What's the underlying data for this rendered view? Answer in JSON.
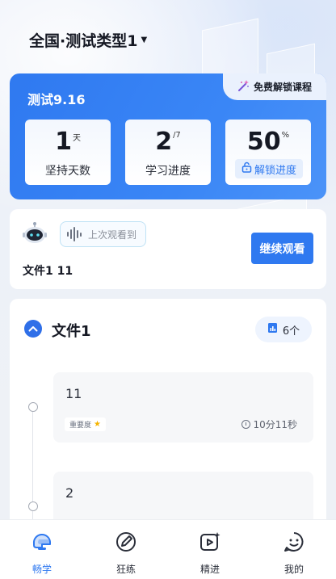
{
  "header": {
    "title": "全国·测试类型1",
    "caret": "▼"
  },
  "stats": {
    "title": "测试9.16",
    "unlock_course_label": "免费解锁课程",
    "days": {
      "value": "1",
      "unit": "天",
      "label": "坚持天数"
    },
    "study": {
      "value": "2",
      "total": "/7",
      "label": "学习进度"
    },
    "progress": {
      "value": "50",
      "unit": "%",
      "button_label": "解锁进度"
    }
  },
  "watch": {
    "last_label": "上次观看到",
    "file_name": "文件1 11",
    "continue_label": "继续观看"
  },
  "files": {
    "title": "文件1",
    "count": "6个",
    "lessons": [
      {
        "title": "11",
        "importance_label": "重要度",
        "duration": "10分11秒"
      },
      {
        "title": "2"
      }
    ]
  },
  "tabbar": {
    "items": [
      {
        "label": "畅学",
        "icon": "helmet-icon"
      },
      {
        "label": "狂练",
        "icon": "pen-icon"
      },
      {
        "label": "精进",
        "icon": "video-star-icon"
      },
      {
        "label": "我的",
        "icon": "face-icon"
      }
    ],
    "active_color": "#2F79F0"
  },
  "colors": {
    "primary": "#2F79F0",
    "star": "#F5B400"
  }
}
